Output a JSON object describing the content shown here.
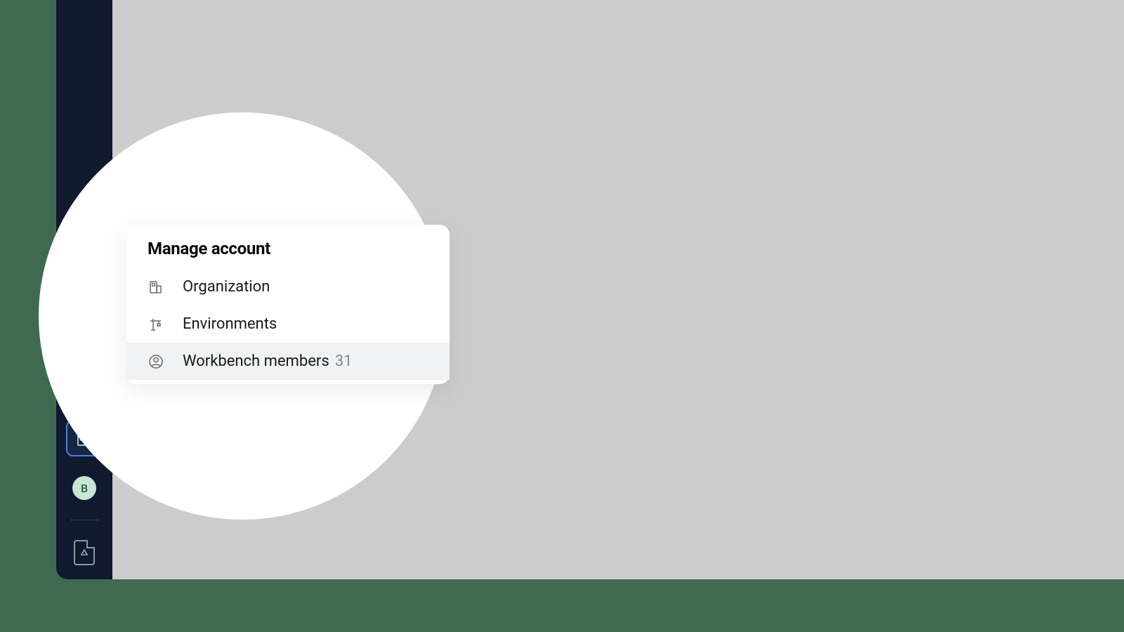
{
  "sidebar": {
    "avatar_initial": "B"
  },
  "popover": {
    "title": "Manage account",
    "items": [
      {
        "label": "Organization",
        "count": null
      },
      {
        "label": "Environments",
        "count": null
      },
      {
        "label": "Workbench members",
        "count": "31"
      }
    ]
  }
}
